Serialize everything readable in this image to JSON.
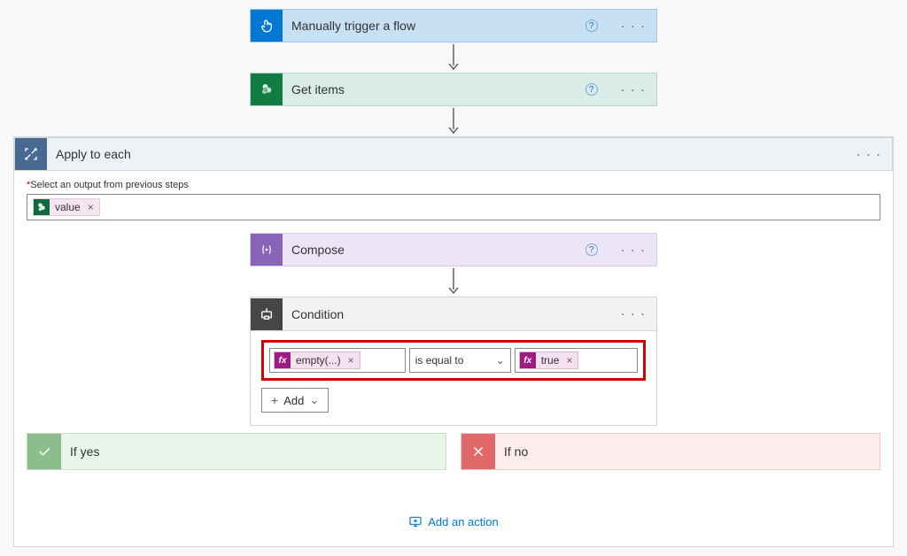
{
  "trigger": {
    "title": "Manually trigger a flow"
  },
  "getItems": {
    "title": "Get items"
  },
  "applyToEach": {
    "title": "Apply to each",
    "fieldLabel": "Select an output from previous steps",
    "token": {
      "label": "value"
    }
  },
  "compose": {
    "title": "Compose"
  },
  "condition": {
    "title": "Condition",
    "left": {
      "fxLabel": "fx",
      "expr": "empty(...)"
    },
    "operator": "is equal to",
    "right": {
      "fxLabel": "fx",
      "expr": "true"
    },
    "addLabel": "Add"
  },
  "branches": {
    "yes": "If yes",
    "no": "If no"
  },
  "footer": {
    "addAction": "Add an action"
  }
}
